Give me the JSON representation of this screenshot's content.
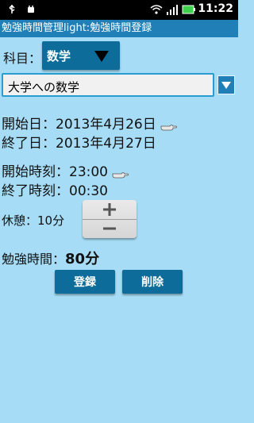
{
  "status_bar": {
    "time": "11:22",
    "icons": [
      "usb-icon",
      "android-debug-icon",
      "wifi-icon",
      "signal-icon",
      "battery-icon"
    ]
  },
  "app": {
    "title": "勉強時間管理light:勉強時間登録"
  },
  "subject": {
    "label": "科目：",
    "value": "数学"
  },
  "material": {
    "value": "大学への数学"
  },
  "dates": {
    "start_label": "開始日：",
    "start_value": "2013年4月26日",
    "end_label": "終了日：",
    "end_value": "2013年4月27日"
  },
  "times": {
    "start_label": "開始時刻：",
    "start_value": "23:00",
    "end_label": "終了時刻：",
    "end_value": "00:30"
  },
  "rest": {
    "label": "休憩：",
    "value": "10分"
  },
  "study": {
    "label": "勉強時間：",
    "value": "80分"
  },
  "buttons": {
    "register": "登録",
    "delete": "削除"
  },
  "colors": {
    "background": "#a6dcf5",
    "titlebar": "#1f7fb6",
    "button": "#0d6c99"
  }
}
